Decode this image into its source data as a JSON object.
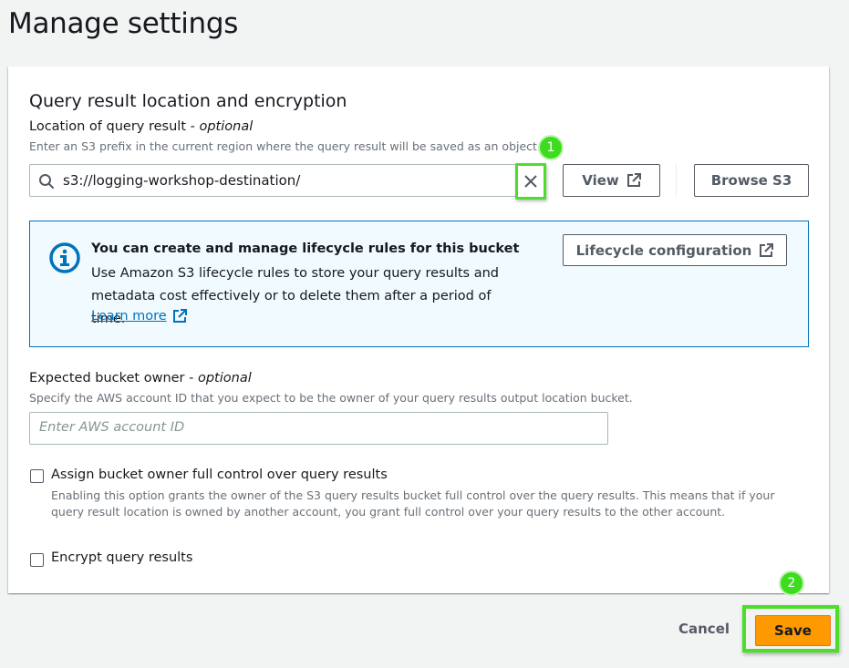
{
  "page": {
    "title": "Manage settings"
  },
  "query_result": {
    "section_title": "Query result location and encryption",
    "location_label": "Location of query result - ",
    "location_optional": "optional",
    "location_desc": "Enter an S3 prefix in the current region where the query result will be saved as an object.",
    "location_value": "s3://logging-workshop-destination/",
    "view_button": "View",
    "browse_button": "Browse S3"
  },
  "annotations": {
    "badge1": "1",
    "badge2": "2"
  },
  "info": {
    "title": "You can create and manage lifecycle rules for this bucket",
    "text": "Use Amazon S3 lifecycle rules to store your query results and metadata cost effectively or to delete them after a period of time.",
    "link": "Learn more",
    "lifecycle_button": "Lifecycle configuration"
  },
  "bucket_owner": {
    "label": "Expected bucket owner - ",
    "optional": "optional",
    "desc": "Specify the AWS account ID that you expect to be the owner of your query results output location bucket.",
    "placeholder": "Enter AWS account ID"
  },
  "assign_control": {
    "label": "Assign bucket owner full control over query results",
    "desc": "Enabling this option grants the owner of the S3 query results bucket full control over the query results. This means that if your query result location is owned by another account, you grant full control over your query results to the other account.",
    "checked": false
  },
  "encrypt": {
    "label": "Encrypt query results",
    "checked": false
  },
  "footer": {
    "cancel": "Cancel",
    "save": "Save"
  },
  "colors": {
    "accent": "#ff9900",
    "highlight": "#4cde2a",
    "link": "#0073bb",
    "info_bg": "#f1faff"
  }
}
